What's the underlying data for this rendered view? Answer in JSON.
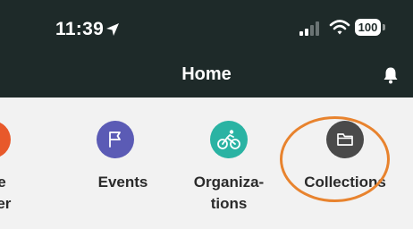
{
  "status_bar": {
    "time": "11:39",
    "battery": "100",
    "icons": [
      "location-arrow-icon",
      "signal-bars-icon",
      "wifi-icon",
      "battery-icon"
    ]
  },
  "header": {
    "title": "Home",
    "icon": "bell-icon"
  },
  "quick_links": [
    {
      "label_line1": "ute",
      "label_line2": "nner",
      "icon": "map-icon",
      "color": "#e8592b"
    },
    {
      "label_line1": "Events",
      "label_line2": "",
      "icon": "flag-icon",
      "color": "#5b5bb5"
    },
    {
      "label_line1": "Organiza-",
      "label_line2": "tions",
      "icon": "cyclist-icon",
      "color": "#2ab3a3"
    },
    {
      "label_line1": "Collections",
      "label_line2": "",
      "icon": "folder-icon",
      "color": "#4a4a4a"
    }
  ],
  "colors": {
    "header_bg": "#1e2a29",
    "content_bg": "#f2f2f2",
    "highlight": "#e8832e"
  }
}
